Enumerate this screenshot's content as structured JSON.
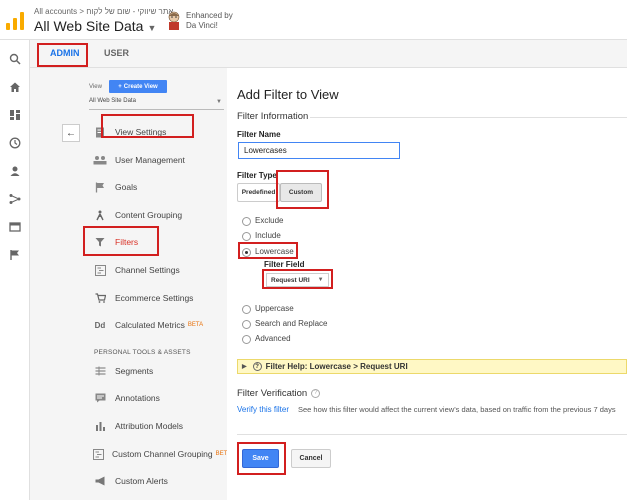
{
  "header": {
    "breadcrumb": "All accounts > אתר שיווקי - שום של לקוח",
    "property_title": "All Web Site Data",
    "enhanced_line1": "Enhanced by",
    "enhanced_line2": "Da Vinci!"
  },
  "rail": {
    "icons": [
      "search-icon",
      "home-icon",
      "dashboard-icon",
      "clock-icon",
      "person-icon",
      "acquisition-icon",
      "behavior-icon",
      "flag-icon"
    ]
  },
  "tabs": {
    "admin": "ADMIN",
    "user": "USER"
  },
  "view_panel": {
    "view_label": "View",
    "create_view": "Create View",
    "selected_view": "All Web Site Data",
    "items": [
      {
        "label": "View Settings",
        "icon": "document-icon",
        "active": false
      },
      {
        "label": "User Management",
        "icon": "users-icon",
        "active": false
      },
      {
        "label": "Goals",
        "icon": "flag-icon",
        "active": false
      },
      {
        "label": "Content Grouping",
        "icon": "person-walk-icon",
        "active": false
      },
      {
        "label": "Filters",
        "icon": "funnel-icon",
        "active": true
      },
      {
        "label": "Channel Settings",
        "icon": "channel-icon",
        "active": false
      },
      {
        "label": "Ecommerce Settings",
        "icon": "cart-icon",
        "active": false
      },
      {
        "label": "Calculated Metrics",
        "icon": "dd-icon",
        "active": false,
        "badge": "BETA"
      }
    ],
    "personal_header": "PERSONAL TOOLS & ASSETS",
    "personal_items": [
      {
        "label": "Segments",
        "icon": "segments-icon"
      },
      {
        "label": "Annotations",
        "icon": "annotation-icon"
      },
      {
        "label": "Attribution Models",
        "icon": "bar-chart-icon"
      },
      {
        "label": "Custom Channel Grouping",
        "icon": "channel-icon",
        "badge": "BETA"
      },
      {
        "label": "Custom Alerts",
        "icon": "megaphone-icon"
      }
    ]
  },
  "form": {
    "page_title": "Add Filter to View",
    "filter_info_header": "Filter Information",
    "filter_name_label": "Filter Name",
    "filter_name_value": "Lowercases",
    "filter_type_label": "Filter Type",
    "predefined_label": "Predefined",
    "custom_label": "Custom",
    "options": [
      {
        "label": "Exclude",
        "checked": false
      },
      {
        "label": "Include",
        "checked": false
      },
      {
        "label": "Lowercase",
        "checked": true
      }
    ],
    "filter_field_label": "Filter Field",
    "filter_field_value": "Request URI",
    "more_options": [
      {
        "label": "Uppercase",
        "checked": false
      },
      {
        "label": "Search and Replace",
        "checked": false
      },
      {
        "label": "Advanced",
        "checked": false
      }
    ],
    "help_text": "Filter Help: Lowercase  >  Request URI",
    "verification_header": "Filter Verification",
    "verify_link": "Verify this filter",
    "verify_desc": "See how this filter would affect the current view's data, based on traffic from the previous 7 days",
    "save_label": "Save",
    "cancel_label": "Cancel"
  }
}
